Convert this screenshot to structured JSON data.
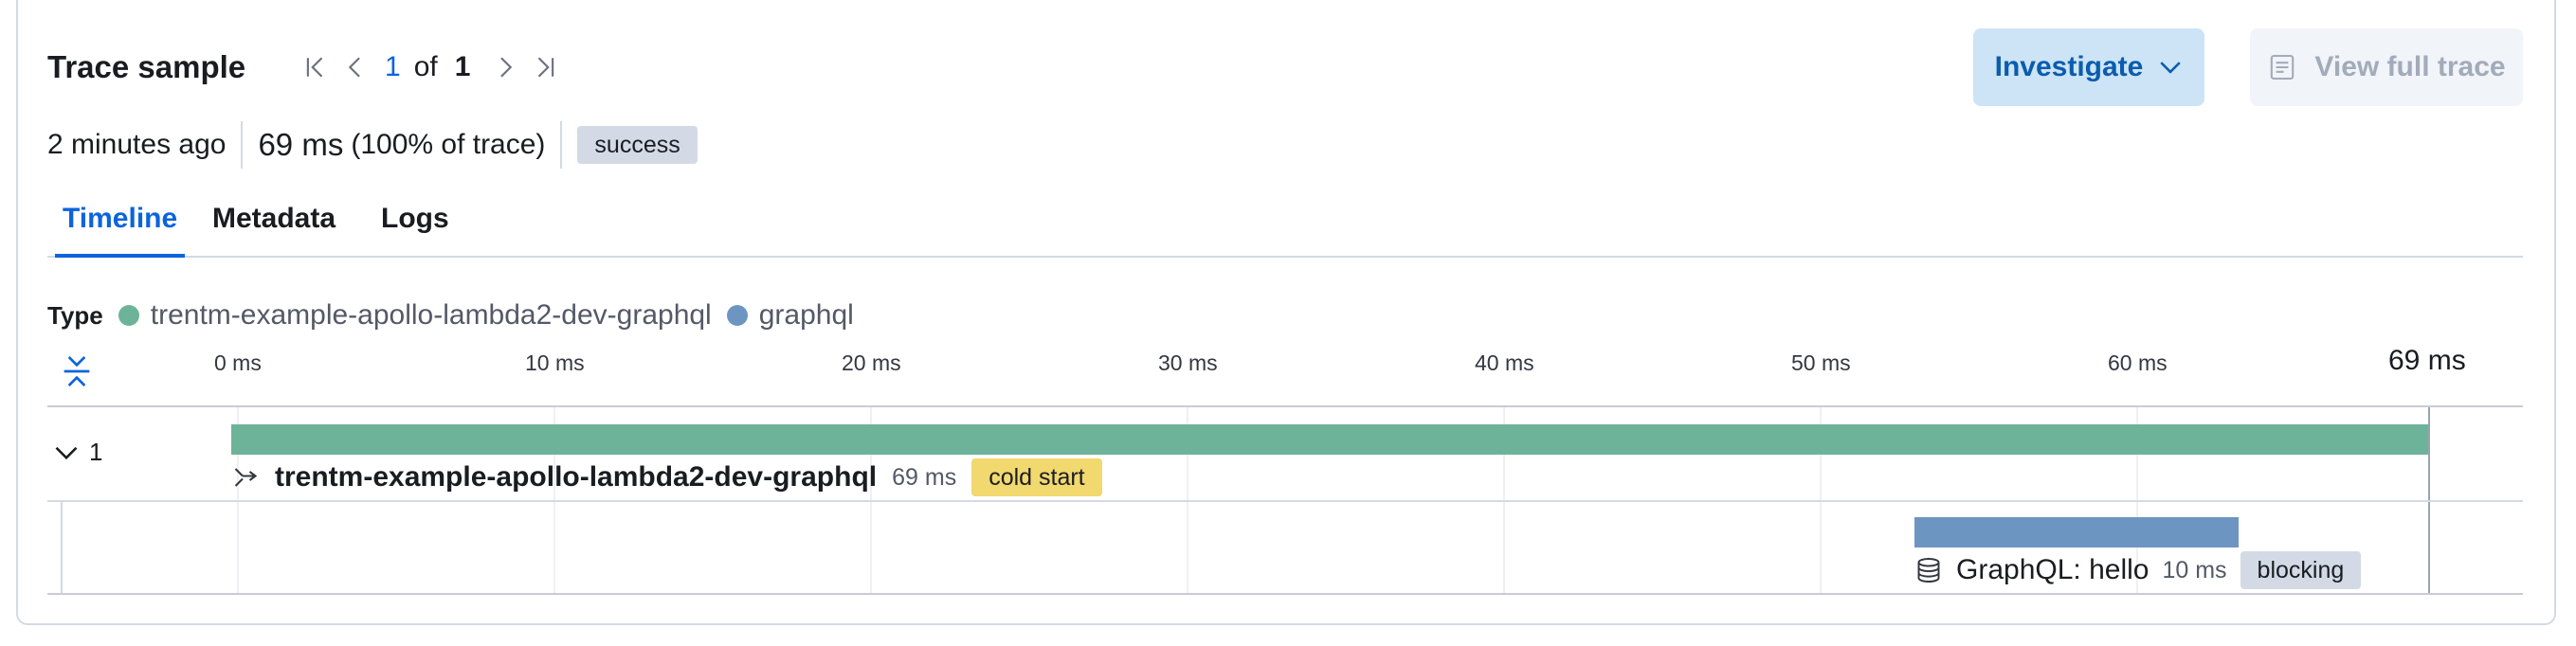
{
  "header": {
    "title": "Trace sample",
    "pager": {
      "current": "1",
      "of_label": "of",
      "total": "1"
    },
    "investigate_label": "Investigate",
    "view_full_trace_label": "View full trace"
  },
  "summary": {
    "time_ago": "2 minutes ago",
    "duration": "69 ms",
    "percent": "(100% of trace)",
    "status": "success"
  },
  "tabs": [
    {
      "label": "Timeline",
      "active": true
    },
    {
      "label": "Metadata",
      "active": false
    },
    {
      "label": "Logs",
      "active": false
    }
  ],
  "legend": {
    "label": "Type",
    "items": [
      {
        "label": "trentm-example-apollo-lambda2-dev-graphql",
        "color": "#6db39a"
      },
      {
        "label": "graphql",
        "color": "#6d95c2"
      }
    ]
  },
  "timeline": {
    "ticks": [
      "0 ms",
      "10 ms",
      "20 ms",
      "30 ms",
      "40 ms",
      "50 ms",
      "60 ms"
    ],
    "total": "69 ms",
    "group_count": "1",
    "spans": [
      {
        "name": "trentm-example-apollo-lambda2-dev-graphql",
        "duration": "69 ms",
        "badge": "cold start",
        "icon": "transaction-icon",
        "color": "#6db39a"
      },
      {
        "name": "GraphQL: hello",
        "duration": "10 ms",
        "badge": "blocking",
        "icon": "database-icon",
        "color": "#6d95c2"
      }
    ]
  },
  "colors": {
    "accent": "#0b64dd",
    "investigate_bg": "#cce4f5",
    "cold_start_badge": "#f1d86f",
    "neutral_badge": "#d3dae6"
  }
}
